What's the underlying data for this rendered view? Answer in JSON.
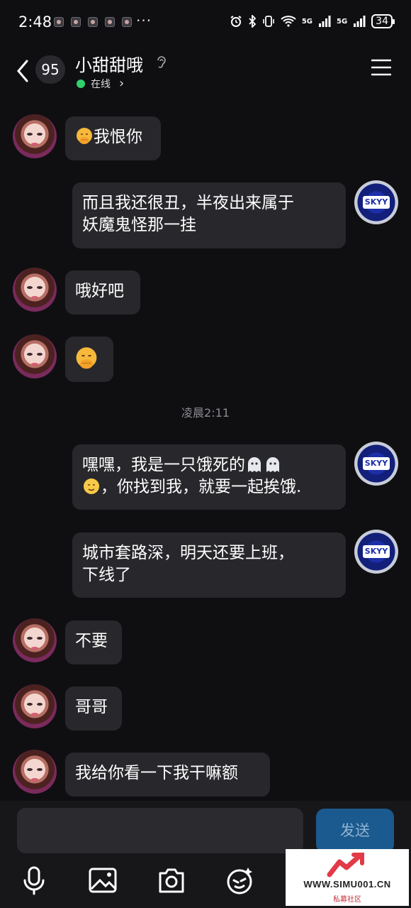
{
  "status_bar": {
    "time": "2:48",
    "dots": "···",
    "network": "5G",
    "battery": "34"
  },
  "header": {
    "unread_count": "95",
    "contact_name": "小甜甜哦",
    "status_text": "在线",
    "status_chevron": "›"
  },
  "messages": [
    {
      "side": "left",
      "text": "我恨你",
      "emoji_before": "face-with-hand-over-mouth"
    },
    {
      "side": "right",
      "line1": "而且我还很丑，半夜出来属于",
      "line2": "妖魔鬼怪那一挂"
    },
    {
      "side": "left",
      "text": "哦好吧"
    },
    {
      "side": "left",
      "emoji_only": "face-with-hand-over-mouth"
    },
    {
      "side": "right",
      "line1": "嘿嘿，我是一只饿死的",
      "line2": "，你找到我，就要一起挨饿."
    },
    {
      "side": "right",
      "line1": "城市套路深，明天还要上班，",
      "line2": "下线了"
    },
    {
      "side": "left",
      "text": "不要"
    },
    {
      "side": "left",
      "text": "哥哥"
    },
    {
      "side": "left",
      "text": "我给你看一下我干嘛额"
    }
  ],
  "timestamp": "凌晨2:11",
  "composer": {
    "send_label": "发送"
  },
  "avatar_label": "SKYY",
  "watermark": {
    "url": "WWW.SIMU001.CN",
    "sub": "私募社区"
  }
}
